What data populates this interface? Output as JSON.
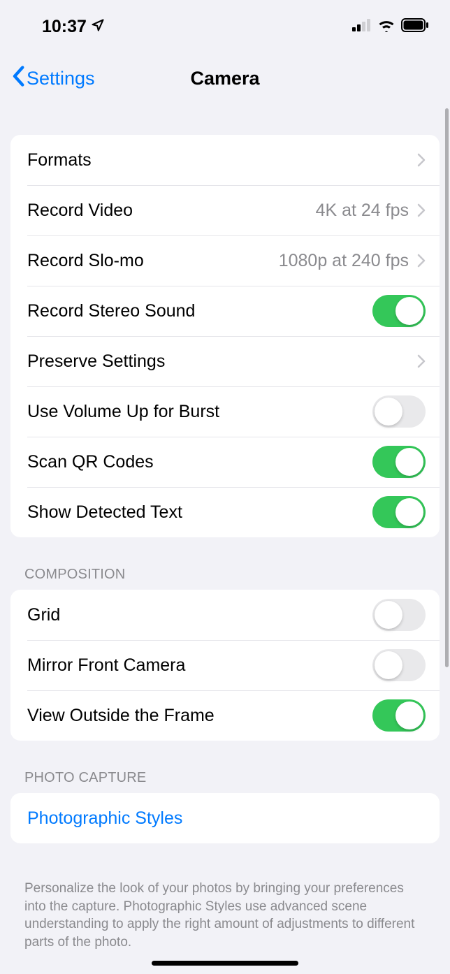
{
  "status": {
    "time": "10:37"
  },
  "nav": {
    "back_label": "Settings",
    "title": "Camera"
  },
  "group1": {
    "formats": "Formats",
    "record_video": "Record Video",
    "record_video_value": "4K at 24 fps",
    "record_slomo": "Record Slo-mo",
    "record_slomo_value": "1080p at 240 fps",
    "record_stereo": "Record Stereo Sound",
    "preserve_settings": "Preserve Settings",
    "volume_burst": "Use Volume Up for Burst",
    "scan_qr": "Scan QR Codes",
    "show_detected_text": "Show Detected Text"
  },
  "composition": {
    "header": "COMPOSITION",
    "grid": "Grid",
    "mirror": "Mirror Front Camera",
    "view_outside": "View Outside the Frame"
  },
  "photo_capture": {
    "header": "PHOTO CAPTURE",
    "photographic_styles": "Photographic Styles",
    "footer": "Personalize the look of your photos by bringing your preferences into the capture. Photographic Styles use advanced scene understanding to apply the right amount of adjustments to different parts of the photo."
  }
}
